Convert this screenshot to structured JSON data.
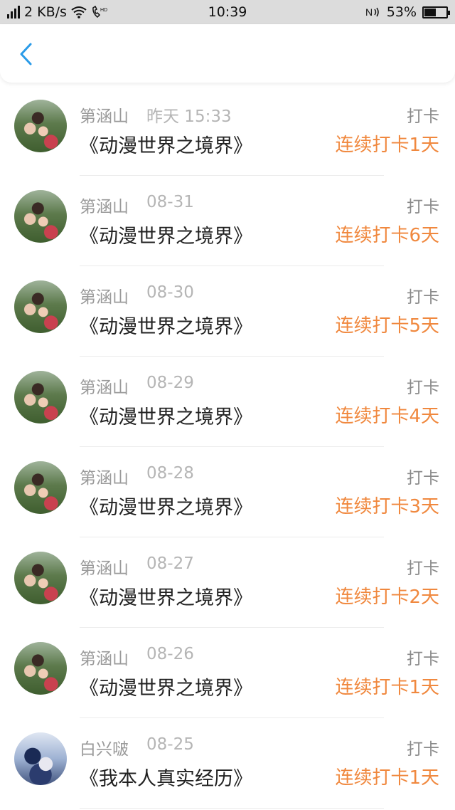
{
  "status_bar": {
    "network": "2 KB/s",
    "time": "10:39",
    "battery_percent": "53%",
    "battery_level": 0.53,
    "icons": [
      "signal-icon",
      "wifi-icon",
      "hd-call-icon",
      "nfc-icon",
      "battery-icon"
    ]
  },
  "nav": {
    "back_icon": "chevron-left-icon",
    "accent_color": "#2a9be8"
  },
  "colors": {
    "streak": "#f0883e",
    "name": "#9a9a9a",
    "tag": "#8a8a8a"
  },
  "items": [
    {
      "name": "第涵山",
      "time": "昨天 15:33",
      "tag": "打卡",
      "title": "《动漫世界之境界》",
      "streak": "连续打卡1天",
      "avatar": "photo-a"
    },
    {
      "name": "第涵山",
      "time": "08-31",
      "tag": "打卡",
      "title": "《动漫世界之境界》",
      "streak": "连续打卡6天",
      "avatar": "photo-a"
    },
    {
      "name": "第涵山",
      "time": "08-30",
      "tag": "打卡",
      "title": "《动漫世界之境界》",
      "streak": "连续打卡5天",
      "avatar": "photo-a"
    },
    {
      "name": "第涵山",
      "time": "08-29",
      "tag": "打卡",
      "title": "《动漫世界之境界》",
      "streak": "连续打卡4天",
      "avatar": "photo-a"
    },
    {
      "name": "第涵山",
      "time": "08-28",
      "tag": "打卡",
      "title": "《动漫世界之境界》",
      "streak": "连续打卡3天",
      "avatar": "photo-a"
    },
    {
      "name": "第涵山",
      "time": "08-27",
      "tag": "打卡",
      "title": "《动漫世界之境界》",
      "streak": "连续打卡2天",
      "avatar": "photo-a"
    },
    {
      "name": "第涵山",
      "time": "08-26",
      "tag": "打卡",
      "title": "《动漫世界之境界》",
      "streak": "连续打卡1天",
      "avatar": "photo-a"
    },
    {
      "name": "白兴啵",
      "time": "08-25",
      "tag": "打卡",
      "title": "《我本人真实经历》",
      "streak": "连续打卡1天",
      "avatar": "photo-b"
    }
  ]
}
